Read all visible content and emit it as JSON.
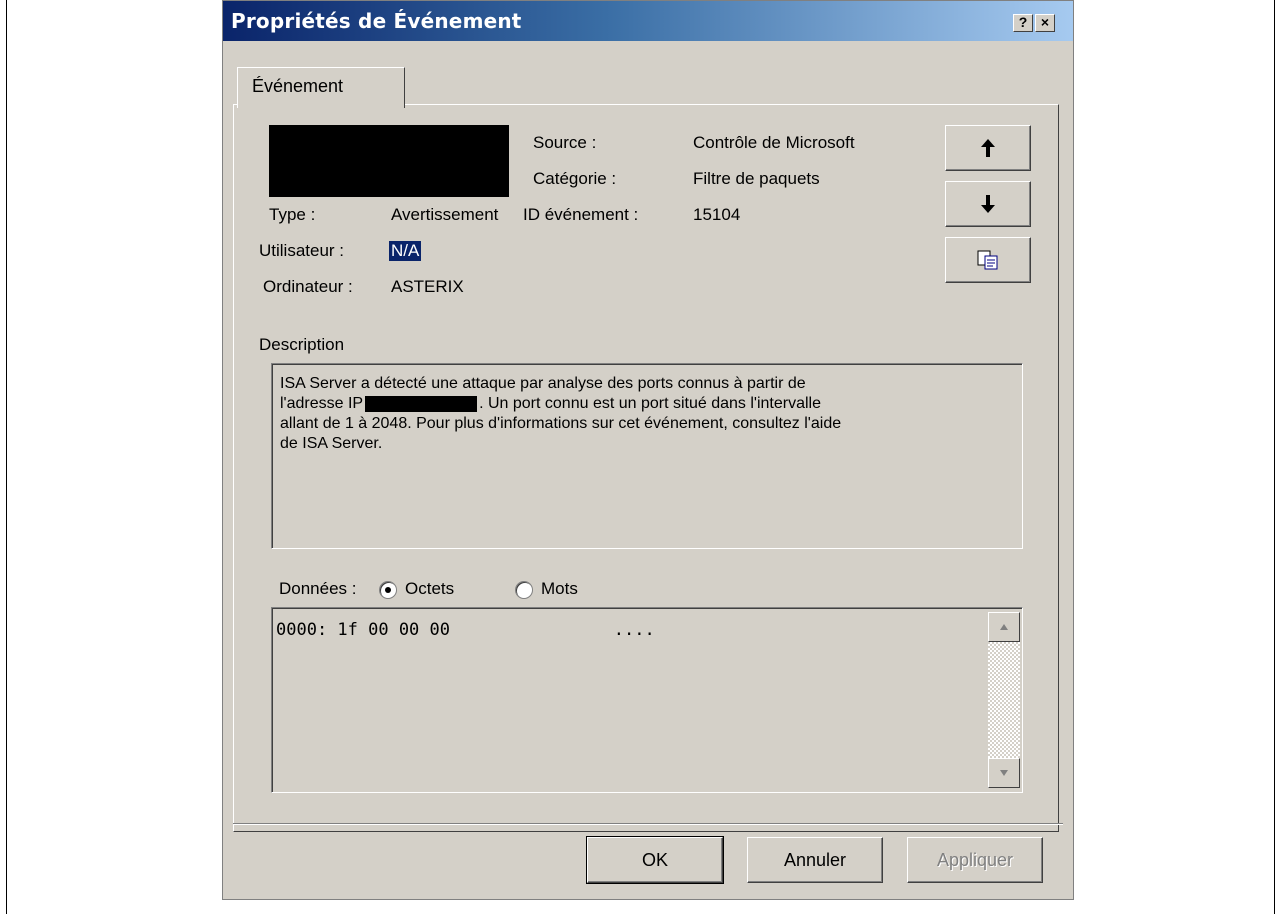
{
  "dialog": {
    "title": "Propriétés de Événement",
    "help_label": "?",
    "close_label": "×"
  },
  "tabs": [
    {
      "label": "Événement"
    }
  ],
  "fields": {
    "source_label": "Source :",
    "source_value": "Contrôle de Microsoft",
    "category_label": "Catégorie :",
    "category_value": "Filtre de paquets",
    "type_label": "Type :",
    "type_value": "Avertissement",
    "event_id_label": "ID événement :",
    "event_id_value": "15104",
    "user_label": "Utilisateur :",
    "user_value": "N/A",
    "computer_label": "Ordinateur :",
    "computer_value": "ASTERIX"
  },
  "nav_buttons": {
    "up_icon": "arrow-up-icon",
    "down_icon": "arrow-down-icon",
    "copy_icon": "copy-icon"
  },
  "description": {
    "label": "Description",
    "line1": "ISA Server a détecté une attaque par analyse des ports connus à partir de",
    "line2a": "l'adresse IP",
    "line2b": ". Un port connu est un port situé dans l'intervalle",
    "line3": "allant de 1 à 2048. Pour plus d'informations sur cet événement, consultez l'aide",
    "line4": "de ISA Server."
  },
  "data": {
    "label": "Données :",
    "option_bytes": "Octets",
    "option_words": "Mots",
    "selected": "Octets",
    "line": "0000: 1f 00 00 00                ...."
  },
  "buttons": {
    "ok": "OK",
    "cancel": "Annuler",
    "apply": "Appliquer"
  }
}
